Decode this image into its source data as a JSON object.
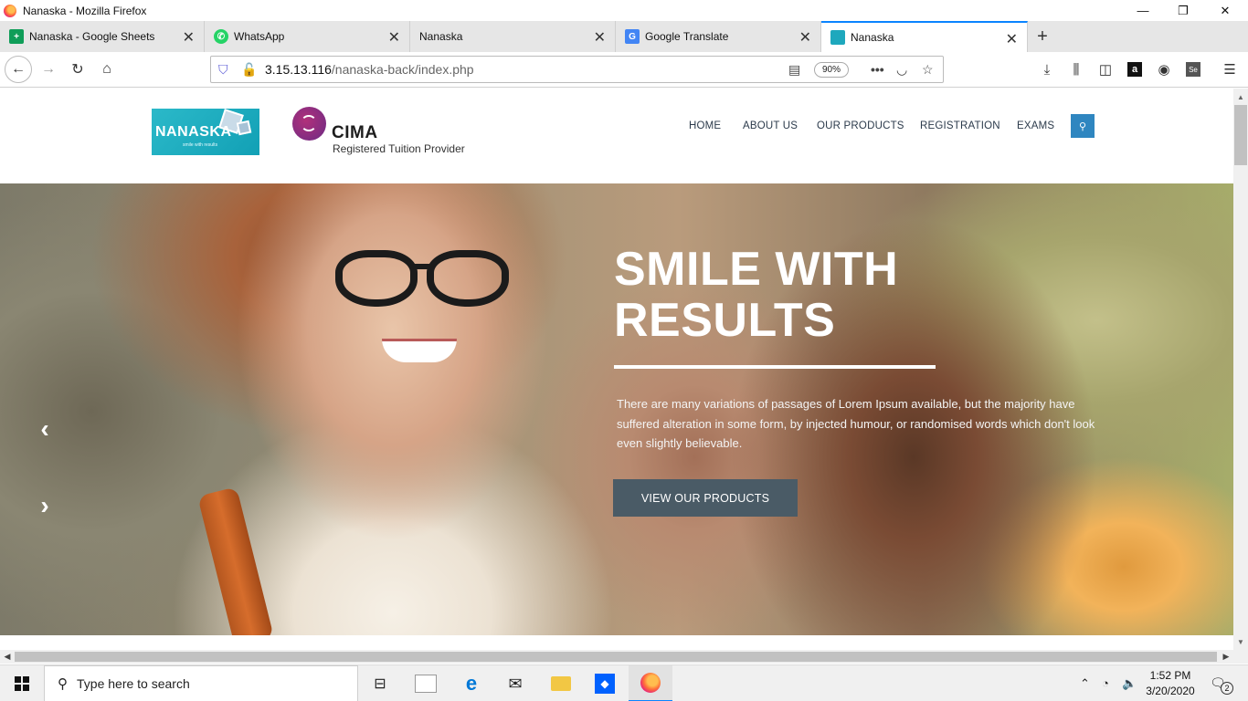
{
  "window": {
    "title": "Nanaska - Mozilla Firefox",
    "minimize_glyph": "—",
    "maximize_glyph": "❐",
    "close_glyph": "✕"
  },
  "tabs": [
    {
      "label": "Nanaska - Google Sheets",
      "icon": "sheets-icon",
      "color": "#0f9d58"
    },
    {
      "label": "WhatsApp",
      "icon": "whatsapp-icon",
      "color": "#25d366"
    },
    {
      "label": "Nanaska",
      "icon": "none",
      "color": ""
    },
    {
      "label": "Google Translate",
      "icon": "translate-icon",
      "color": "#4285f4"
    },
    {
      "label": "Nanaska",
      "icon": "nanaska-icon",
      "color": "#1ea8bd",
      "active": true
    }
  ],
  "toolbar": {
    "url_host": "3.15.13.116",
    "url_path": "/nanaska-back/index.php",
    "zoom": "90%"
  },
  "site": {
    "logo_text": "NANASKA",
    "logo_tagline": "smile with results",
    "cima_word": "CIMA",
    "cima_sub": "Registered Tuition Provider",
    "menu": [
      "HOME",
      "ABOUT US",
      "OUR PRODUCTS",
      "REGISTRATION",
      "EXAMS"
    ],
    "accent": "#2f86c0"
  },
  "hero": {
    "title_line1": "SMILE WITH",
    "title_line2": "RESULTS",
    "text": "There are many variations of passages of Lorem Ipsum available, but the majority have suffered alteration in some form, by injected humour, or randomised words which don't look even slightly believable.",
    "button": "VIEW OUR PRODUCTS",
    "button_color": "#4a5b66"
  },
  "taskbar": {
    "search_placeholder": "Type here to search",
    "time": "1:52 PM",
    "date": "3/20/2020",
    "notification_count": "2"
  }
}
